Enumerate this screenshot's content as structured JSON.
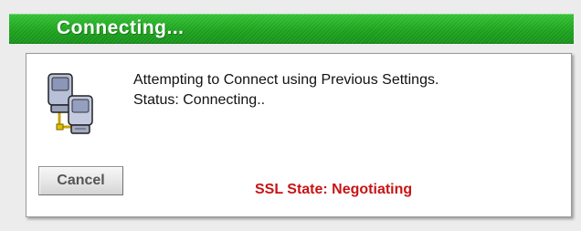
{
  "window": {
    "title": "Connecting..."
  },
  "dialog": {
    "icon": "networked-computers-icon",
    "message_line1": "Attempting to Connect using Previous Settings.",
    "message_line2": "Status: Connecting..",
    "cancel_label": "Cancel",
    "ssl_state": "SSL State: Negotiating"
  },
  "colors": {
    "title_bar": "#1faa1f",
    "ssl_state_text": "#c81414"
  }
}
